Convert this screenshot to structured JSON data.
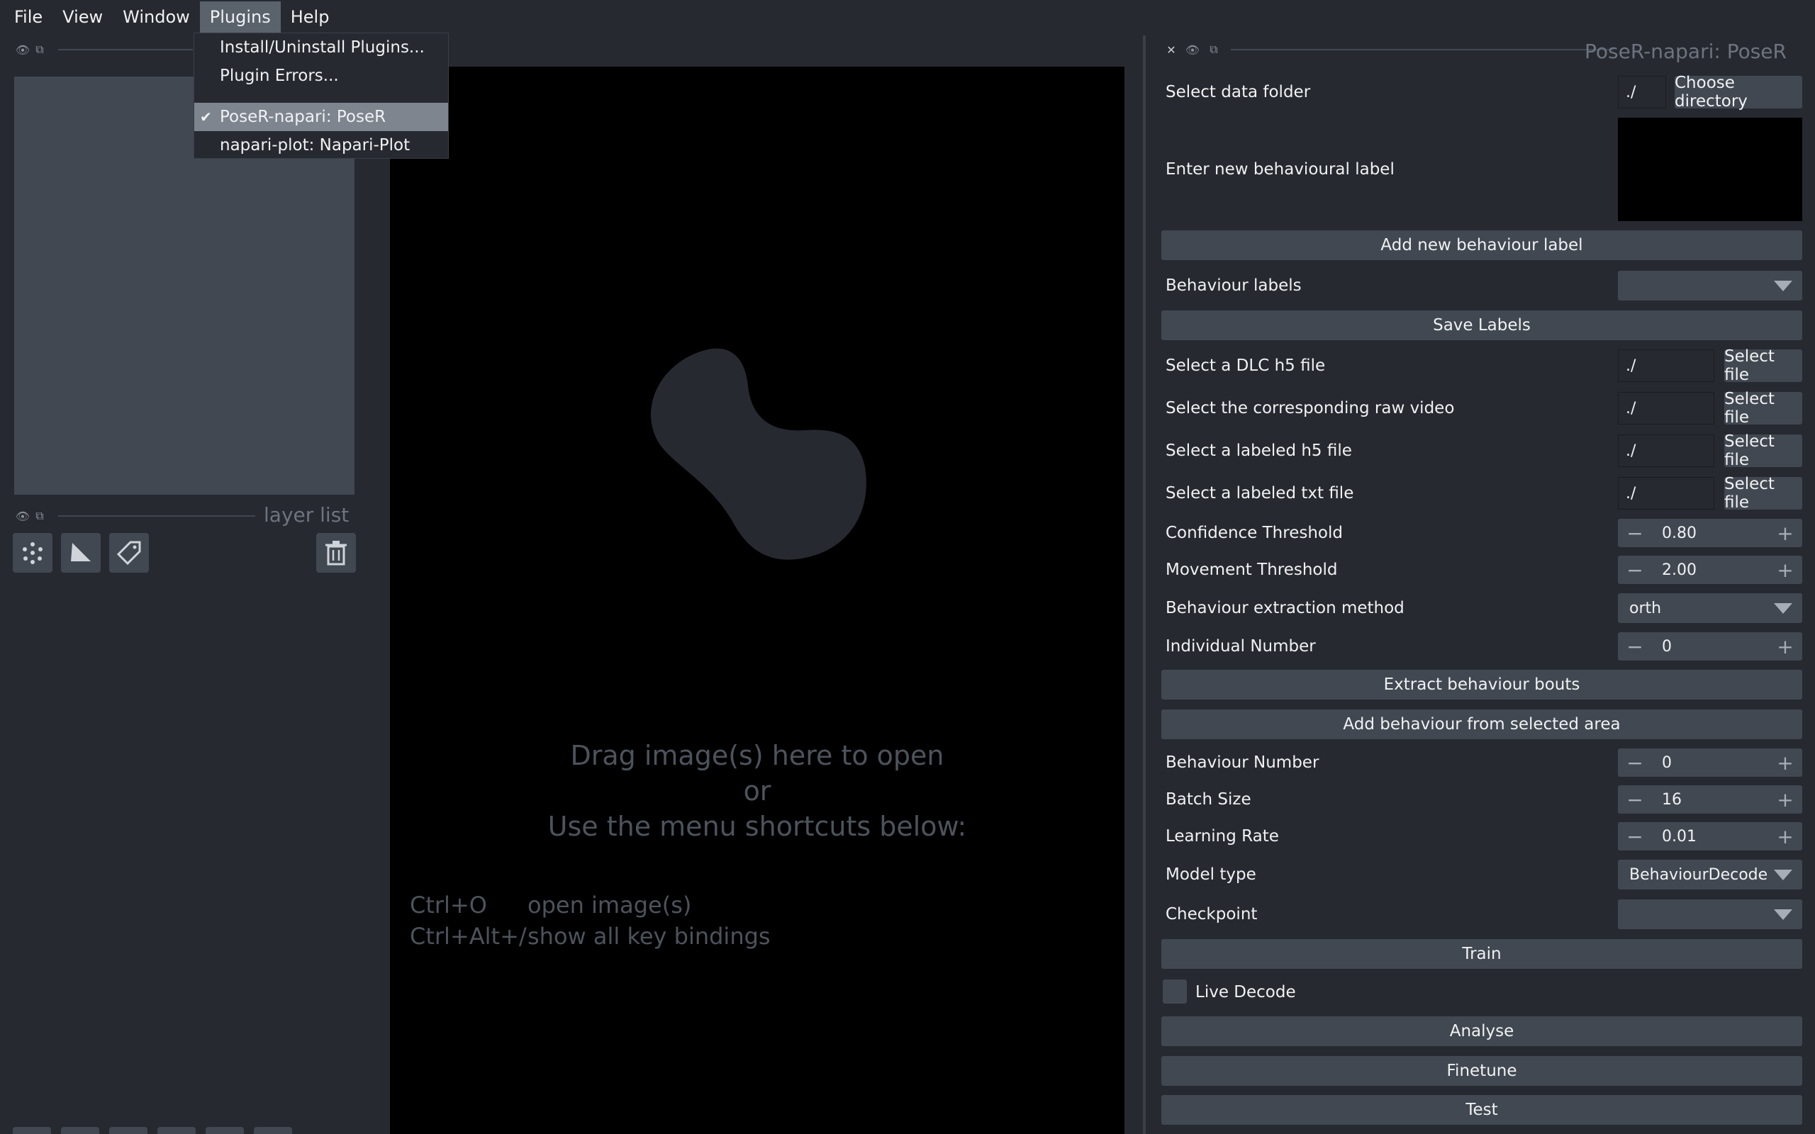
{
  "menubar": {
    "items": [
      "File",
      "View",
      "Window",
      "Plugins",
      "Help"
    ],
    "active": "Plugins"
  },
  "plugins_menu": {
    "install": "Install/Uninstall Plugins...",
    "errors": "Plugin Errors...",
    "poser": "PoseR-napari: PoseR",
    "napari_plot": "napari-plot: Napari-Plot"
  },
  "left_dock": {
    "layer_list_label": "layer list",
    "icons": [
      "new-points-icon",
      "new-shapes-icon",
      "new-labels-icon",
      "delete-layer-icon"
    ]
  },
  "canvas": {
    "welcome": {
      "line1": "Drag image(s) here to open",
      "line2": "or",
      "line3": "Use the menu shortcuts below:"
    },
    "shortcuts": [
      {
        "keys": "Ctrl+O",
        "action": "open image(s)"
      },
      {
        "keys": "Ctrl+Alt+/",
        "action": "show all key bindings"
      }
    ]
  },
  "plugin_panel": {
    "title": "PoseR-napari: PoseR",
    "select_data_folder": {
      "label": "Select data folder",
      "value": "./",
      "button": "Choose directory"
    },
    "new_label": {
      "label": "Enter new behavioural label",
      "value": ""
    },
    "add_label_button": "Add new behaviour label",
    "behaviour_labels": {
      "label": "Behaviour labels",
      "value": ""
    },
    "save_labels_button": "Save Labels",
    "files": [
      {
        "label": "Select a DLC h5 file",
        "value": "./",
        "button": "Select file"
      },
      {
        "label": "Select the corresponding raw video",
        "value": "./",
        "button": "Select file"
      },
      {
        "label": "Select a labeled h5 file",
        "value": "./",
        "button": "Select file"
      },
      {
        "label": "Select a labeled txt file",
        "value": "./",
        "button": "Select file"
      }
    ],
    "confidence": {
      "label": "Confidence Threshold",
      "value": "0.80"
    },
    "movement": {
      "label": "Movement Threshold",
      "value": "2.00"
    },
    "extraction": {
      "label": "Behaviour extraction method",
      "value": "orth"
    },
    "individual": {
      "label": "Individual Number",
      "value": "0"
    },
    "extract_button": "Extract behaviour bouts",
    "add_area_button": "Add behaviour from selected area",
    "behaviour_number": {
      "label": "Behaviour Number",
      "value": "0"
    },
    "batch_size": {
      "label": "Batch Size",
      "value": "16"
    },
    "learning_rate": {
      "label": "Learning Rate",
      "value": "0.01"
    },
    "model_type": {
      "label": "Model type",
      "value": "BehaviourDecode"
    },
    "checkpoint": {
      "label": "Checkpoint",
      "value": ""
    },
    "train_button": "Train",
    "live_decode": {
      "label": "Live Decode",
      "checked": false
    },
    "analyse_button": "Analyse",
    "finetune_button": "Finetune",
    "test_button": "Test"
  }
}
